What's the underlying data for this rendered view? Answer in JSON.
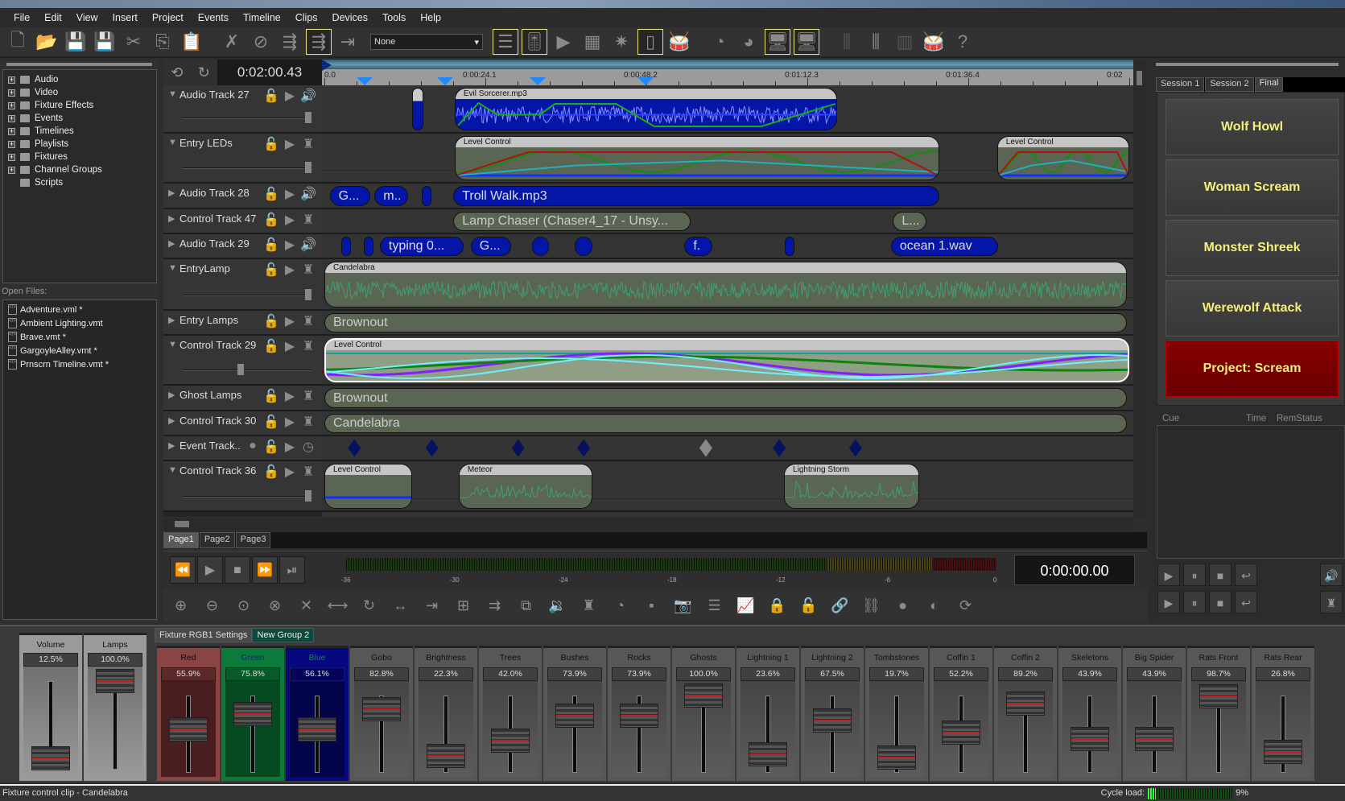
{
  "menu": [
    "File",
    "Edit",
    "View",
    "Insert",
    "Project",
    "Events",
    "Timeline",
    "Clips",
    "Devices",
    "Tools",
    "Help"
  ],
  "toolbar": {
    "preset_value": "None",
    "icons": [
      {
        "name": "new-file-icon",
        "g": "🗋"
      },
      {
        "name": "open-folder-icon",
        "g": "📂"
      },
      {
        "name": "save-icon",
        "g": "💾"
      },
      {
        "name": "save-all-icon",
        "g": "💾"
      },
      {
        "name": "cut-icon",
        "g": "✂"
      },
      {
        "name": "copy-icon",
        "g": "⎘"
      },
      {
        "name": "paste-icon",
        "g": "📋",
        "dim": true
      },
      {
        "name": "sep"
      },
      {
        "name": "mute-fixture-icon",
        "g": "✗"
      },
      {
        "name": "disable-icon",
        "g": "⊘"
      },
      {
        "name": "snap-icon",
        "g": "⇶"
      },
      {
        "name": "snap-grid-icon",
        "g": "⇶",
        "on": true
      },
      {
        "name": "snap-marker-icon",
        "g": "⇥"
      },
      {
        "name": "preset"
      },
      {
        "name": "tracks-view-icon",
        "g": "☰",
        "on": true
      },
      {
        "name": "mixer-view-icon",
        "g": "🎚",
        "on": true
      },
      {
        "name": "preview-icon",
        "g": "▶"
      },
      {
        "name": "keypad-icon",
        "g": "▦"
      },
      {
        "name": "light-burst-icon",
        "g": "✷"
      },
      {
        "name": "device-icon",
        "g": "▯",
        "on": true
      },
      {
        "name": "drum-icon",
        "g": "🥁"
      },
      {
        "name": "sep"
      },
      {
        "name": "timer-check-icon",
        "g": "◔"
      },
      {
        "name": "timer-arrow-icon",
        "g": "◕"
      },
      {
        "name": "display-in-icon",
        "g": "🖥",
        "on": true
      },
      {
        "name": "display-out-icon",
        "g": "🖥",
        "on": true
      },
      {
        "name": "sep"
      },
      {
        "name": "fader-minus-icon",
        "g": "⫼",
        "dim": true
      },
      {
        "name": "fader-plus-icon",
        "g": "⫼"
      },
      {
        "name": "rack-icon",
        "g": "▥",
        "dim": true
      },
      {
        "name": "drum-list-icon",
        "g": "🥁"
      },
      {
        "name": "help-icon",
        "g": "?"
      }
    ]
  },
  "tree": [
    "Audio",
    "Video",
    "Fixture Effects",
    "Events",
    "Timelines",
    "Playlists",
    "Fixtures",
    "Channel Groups",
    "Scripts"
  ],
  "open_files_label": "Open Files:",
  "open_files": [
    "Adventure.vml *",
    "Ambient Lighting.vmt",
    "Brave.vmt *",
    "GargoyleAlley.vmt *",
    "Prnscrn Timeline.vmt *"
  ],
  "timeline": {
    "position": "0:02:00.43",
    "ruler_labels": [
      {
        "t": 0,
        "label": "0.0"
      },
      {
        "t": 24.1,
        "label": "0:00:24.1"
      },
      {
        "t": 48.2,
        "label": "0:00:48.2"
      },
      {
        "t": 72.3,
        "label": "0:01:12.3"
      },
      {
        "t": 96.4,
        "label": "0:01:36.4"
      },
      {
        "t": 120.5,
        "label": "0:02"
      }
    ],
    "markers": [
      6.0,
      18.1,
      31.9,
      48.1
    ],
    "tracks": [
      {
        "name": "Audio Track 27",
        "expanded": true,
        "kind": "audio",
        "level": 1.0,
        "clips": [
          {
            "label": "",
            "start": 13.1,
            "end": 14.8,
            "type": "audio-mini"
          },
          {
            "label": "Evil Sorcerer.mp3",
            "start": 19.5,
            "end": 76.7,
            "type": "audio-wave"
          }
        ]
      },
      {
        "name": "Entry LEDs",
        "expanded": true,
        "kind": "fixture",
        "level": 1.0,
        "clips": [
          {
            "label": "Level Control",
            "start": 19.5,
            "end": 92.0,
            "type": "level"
          },
          {
            "label": "Level Control",
            "start": 100.7,
            "end": 120.5,
            "type": "level"
          }
        ]
      },
      {
        "name": "Audio Track 28",
        "expanded": false,
        "kind": "audio",
        "clips": [
          {
            "label": "G...",
            "start": 0.8,
            "end": 6.9,
            "type": "audio"
          },
          {
            "label": "m..",
            "start": 7.5,
            "end": 12.5,
            "type": "audio"
          },
          {
            "label": "",
            "start": 14.6,
            "end": 16.0,
            "type": "audio"
          },
          {
            "label": "Troll Walk.mp3",
            "start": 19.3,
            "end": 92.0,
            "type": "audio"
          }
        ]
      },
      {
        "name": "Control Track 47",
        "expanded": false,
        "kind": "fixture",
        "clips": [
          {
            "label": "Lamp Chaser (Chaser4_17 - Unsy...",
            "start": 19.3,
            "end": 54.8,
            "type": "control"
          },
          {
            "label": "L...",
            "start": 85.1,
            "end": 90.1,
            "type": "control"
          }
        ]
      },
      {
        "name": "Audio Track 29",
        "expanded": false,
        "kind": "audio",
        "clips": [
          {
            "label": "",
            "start": 2.5,
            "end": 3.5,
            "type": "audio"
          },
          {
            "label": "",
            "start": 5.9,
            "end": 6.9,
            "type": "audio"
          },
          {
            "label": "typing 0...",
            "start": 8.3,
            "end": 20.8,
            "type": "audio"
          },
          {
            "label": "G...",
            "start": 21.9,
            "end": 28.0,
            "type": "audio"
          },
          {
            "label": "",
            "start": 31.1,
            "end": 33.6,
            "type": "audio"
          },
          {
            "label": "",
            "start": 37.5,
            "end": 40.1,
            "type": "audio"
          },
          {
            "label": "f.",
            "start": 53.9,
            "end": 58.1,
            "type": "audio"
          },
          {
            "label": "",
            "start": 68.9,
            "end": 70.0,
            "type": "audio"
          },
          {
            "label": "ocean 1.wav",
            "start": 84.8,
            "end": 100.8,
            "type": "audio"
          }
        ]
      },
      {
        "name": "EntryLamp",
        "expanded": true,
        "kind": "fixture",
        "level": 1.0,
        "clips": [
          {
            "label": "Candelabra",
            "start": 0,
            "end": 120.1,
            "type": "wave"
          }
        ]
      },
      {
        "name": "Entry Lamps",
        "expanded": false,
        "kind": "fixture",
        "clips": [
          {
            "label": "Brownout",
            "start": 0,
            "end": 120.1,
            "type": "control"
          }
        ]
      },
      {
        "name": "Control Track 29",
        "expanded": true,
        "kind": "fixture",
        "level": 0.45,
        "clips": [
          {
            "label": "Level Control",
            "start": 0,
            "end": 120.5,
            "type": "level-selected"
          }
        ]
      },
      {
        "name": "Ghost Lamps",
        "expanded": false,
        "kind": "fixture",
        "clips": [
          {
            "label": "Brownout",
            "start": 0,
            "end": 120.1,
            "type": "control"
          }
        ]
      },
      {
        "name": "Control Track 30",
        "expanded": false,
        "kind": "fixture",
        "clips": [
          {
            "label": "Candelabra",
            "start": 0,
            "end": 120.1,
            "type": "control"
          }
        ]
      },
      {
        "name": "Event Track..",
        "expanded": false,
        "kind": "event",
        "events": [
          {
            "t": 4.5
          },
          {
            "t": 16.1
          },
          {
            "t": 29.0
          },
          {
            "t": 38.8
          },
          {
            "t": 57.1,
            "disabled": true
          },
          {
            "t": 68.1
          },
          {
            "t": 79.5
          }
        ]
      },
      {
        "name": "Control Track 36",
        "expanded": true,
        "kind": "fixture",
        "level": 1.0,
        "clips": [
          {
            "label": "Level Control",
            "start": 0,
            "end": 13.1,
            "type": "level-flat"
          },
          {
            "label": "Meteor",
            "start": 20.1,
            "end": 40.1,
            "type": "spikes"
          },
          {
            "label": "Lightning Storm",
            "start": 68.8,
            "end": 89.0,
            "type": "spikes"
          }
        ]
      }
    ]
  },
  "pages": [
    "Page1",
    "Page2",
    "Page3"
  ],
  "transport": {
    "meter_labels": [
      "-36",
      "-30",
      "-24",
      "-18",
      "-12",
      "-6",
      "0"
    ],
    "clock": "0:00:00.00"
  },
  "tools2": [
    "zoom-in-vertical-icon",
    "zoom-out-vertical-icon",
    "zoom-fit-icon",
    "zoom-reset-icon",
    "fit-all-icon",
    "stretch-icon",
    "loop-icon",
    "move-horizontal-icon",
    "move-end-icon",
    "add-lock-icon",
    "insert-icon",
    "split-icon",
    "add-audio-icon",
    "add-fixture-icon",
    "add-timer-icon",
    "add-video-icon",
    "camera-icon",
    "list-icon",
    "chart-icon",
    "lock-icon",
    "unlock-icon",
    "link-icon",
    "unlink-icon",
    "record-icon",
    "record-lock-icon",
    "sync-icon"
  ],
  "sessions": {
    "tabs": [
      "Session 1",
      "Session 2",
      "Final"
    ],
    "active": 2,
    "cues": [
      {
        "label": "Wolf Howl"
      },
      {
        "label": "Woman Scream"
      },
      {
        "label": "Monster Shreek"
      },
      {
        "label": "Werewolf Attack"
      },
      {
        "label": "Project: Scream",
        "active": true
      }
    ],
    "columns": [
      "Cue",
      "Time",
      "RemStatus"
    ]
  },
  "mixer": {
    "masters": [
      {
        "name": "Volume",
        "value": 12.5
      },
      {
        "name": "Lamps",
        "value": 100.0
      }
    ],
    "tabs": [
      "Fixture RGB1 Settings",
      "New Group 2"
    ],
    "channels": [
      {
        "name": "Red",
        "value": 55.9,
        "color": "red"
      },
      {
        "name": "Green",
        "value": 75.8,
        "color": "green"
      },
      {
        "name": "Blue",
        "value": 56.1,
        "color": "blue"
      },
      {
        "name": "Gobo",
        "value": 82.8
      },
      {
        "name": "Brightness",
        "value": 22.3
      },
      {
        "name": "Trees",
        "value": 42.0
      },
      {
        "name": "Bushes",
        "value": 73.9
      },
      {
        "name": "Rocks",
        "value": 73.9
      },
      {
        "name": "Ghosts",
        "value": 100.0
      },
      {
        "name": "Lightning 1",
        "value": 23.6
      },
      {
        "name": "Lightning 2",
        "value": 67.5
      },
      {
        "name": "Tombstones",
        "value": 19.7
      },
      {
        "name": "Coffin 1",
        "value": 52.2
      },
      {
        "name": "Coffin 2",
        "value": 89.2
      },
      {
        "name": "Skeletons",
        "value": 43.9
      },
      {
        "name": "Big Spider",
        "value": 43.9
      },
      {
        "name": "Rats Front",
        "value": 98.7
      },
      {
        "name": "Rats Rear",
        "value": 26.8
      }
    ]
  },
  "status": {
    "text": "Fixture control clip - Candelabra",
    "cycle_label": "Cycle load:",
    "cycle_value": "9%",
    "cycle_fraction": 0.09
  },
  "colors": {
    "audio_clip": "#0416a8",
    "control_clip": "#5a6553",
    "cue_text": "#f3f07a",
    "cue_active": "#7a0000",
    "marker": "#1e88ff",
    "event": "#06125e"
  }
}
